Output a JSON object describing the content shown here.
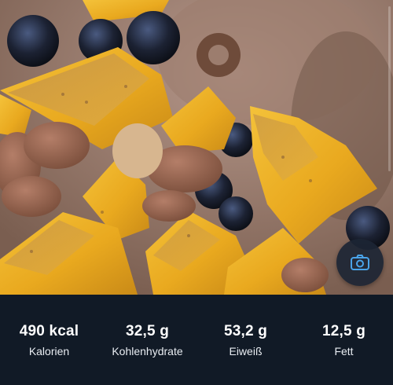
{
  "meal_photo": {
    "icon": "food-photo",
    "camera_icon": "camera-icon",
    "camera_color": "#4aa3e8"
  },
  "nutrition": {
    "calories": {
      "value": "490 kcal",
      "label": "Kalorien"
    },
    "carbs": {
      "value": "32,5 g",
      "label": "Kohlenhydrate"
    },
    "protein": {
      "value": "53,2 g",
      "label": "Eiweiß"
    },
    "fat": {
      "value": "12,5 g",
      "label": "Fett"
    }
  },
  "colors": {
    "bar_background": "#111a26",
    "text": "#ffffff"
  }
}
